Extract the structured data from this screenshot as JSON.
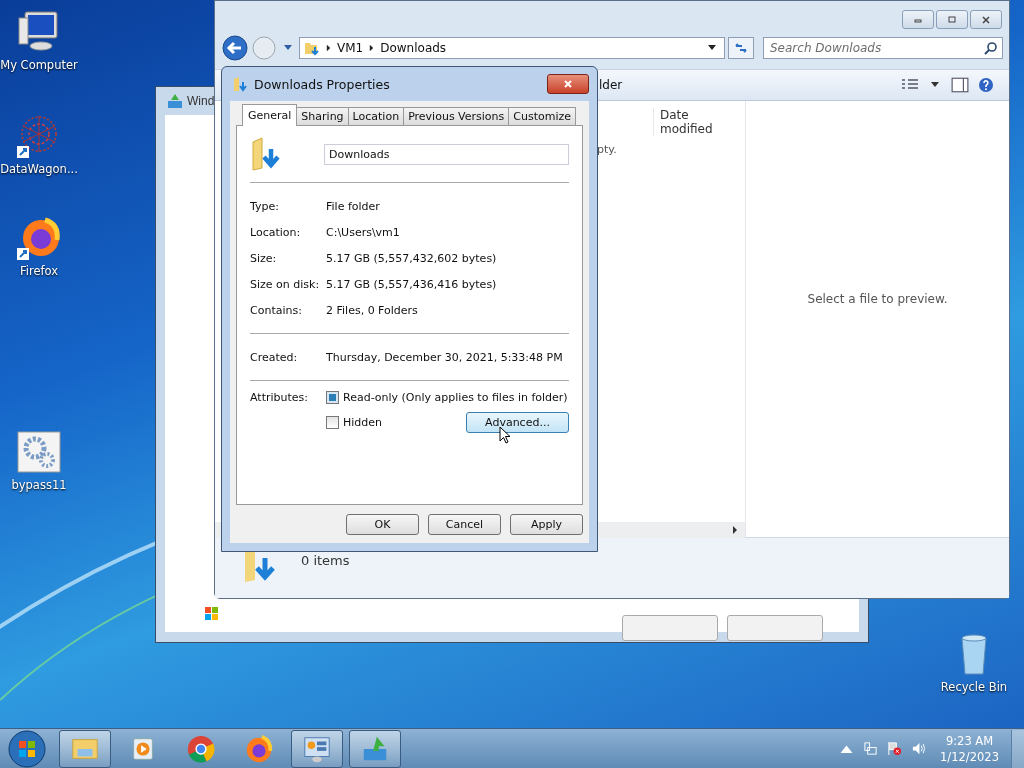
{
  "desktop_icons": [
    {
      "kind": "computer",
      "label": "My Computer"
    },
    {
      "kind": "network",
      "label": "DataWagon..."
    },
    {
      "kind": "firefox",
      "label": "Firefox"
    },
    {
      "kind": "settings",
      "label": "bypass11"
    },
    {
      "kind": "recycle",
      "label": "Recycle Bin"
    }
  ],
  "setup_window": {
    "title": "Wind"
  },
  "explorer": {
    "breadcrumb": [
      "VM1",
      "Downloads"
    ],
    "search": {
      "placeholder": "Search Downloads"
    },
    "toolbar_text": "lder",
    "column_header": "Date modified",
    "empty_text": "pty.",
    "preview_text": "Select a file to preview.",
    "status": "0 items"
  },
  "dialog": {
    "title": "Downloads Properties",
    "tabs": [
      {
        "label": "General",
        "selected": true
      },
      {
        "label": "Sharing",
        "selected": false
      },
      {
        "label": "Location",
        "selected": false
      },
      {
        "label": "Previous Versions",
        "selected": false
      },
      {
        "label": "Customize",
        "selected": false
      }
    ],
    "name": "Downloads",
    "details": [
      {
        "label": "Type:",
        "value": "File folder"
      },
      {
        "label": "Location:",
        "value": "C:\\Users\\vm1"
      },
      {
        "label": "Size:",
        "value": "5.17 GB (5,557,432,602 bytes)"
      },
      {
        "label": "Size on disk:",
        "value": "5.17 GB (5,557,436,416 bytes)"
      },
      {
        "label": "Contains:",
        "value": "2 Files, 0 Folders"
      }
    ],
    "created": {
      "label": "Created:",
      "value": "Thursday, December 30, 2021, 5:33:48 PM"
    },
    "attributes_label": "Attributes:",
    "attributes": [
      {
        "label": "Read-only (Only applies to files in folder)",
        "checked": true
      },
      {
        "label": "Hidden",
        "checked": false
      }
    ],
    "advanced_button": "Advanced...",
    "buttons": [
      "OK",
      "Cancel",
      "Apply"
    ]
  },
  "taskbar": {
    "items": [
      {
        "kind": "explorer",
        "open": true
      },
      {
        "kind": "media",
        "open": false
      },
      {
        "kind": "chrome",
        "open": false
      },
      {
        "kind": "firefox",
        "open": false
      },
      {
        "kind": "control",
        "open": true
      },
      {
        "kind": "installer",
        "open": true
      }
    ],
    "time": "9:23 AM",
    "date": "1/12/2023"
  }
}
